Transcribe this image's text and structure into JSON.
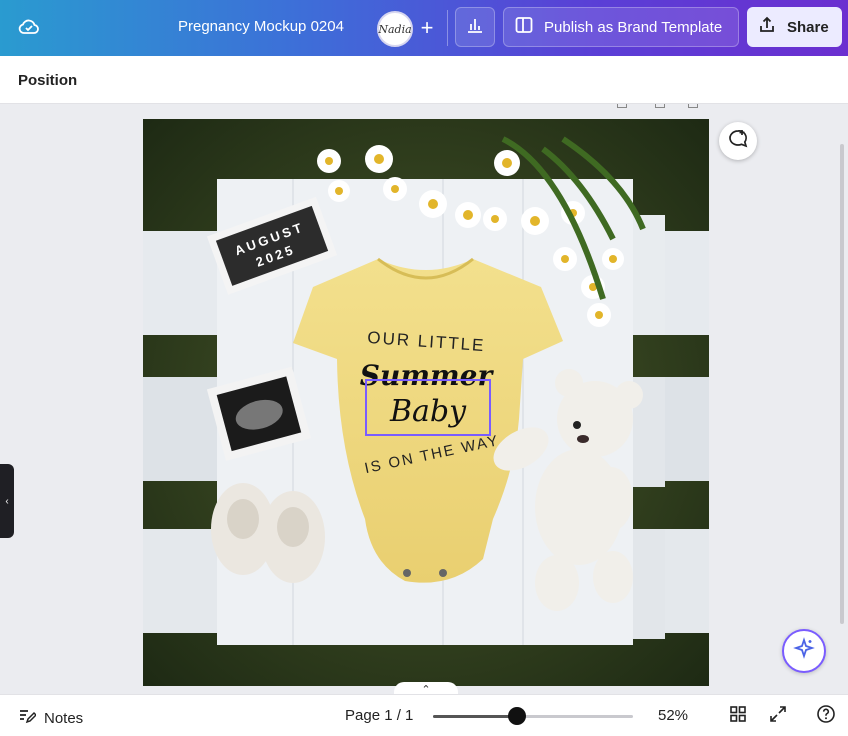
{
  "header": {
    "doc_title": "Pregnancy Mockup 0204",
    "avatar_text": "Nadia",
    "add_label": "+",
    "publish_label": "Publish as Brand Template",
    "share_label": "Share"
  },
  "toolbar": {
    "position_label": "Position"
  },
  "canvas": {
    "letterboard_line1": "AUGUST",
    "letterboard_line2": "2025",
    "onesie_line1": "OUR LITTLE",
    "onesie_line2": "Summer",
    "onesie_line3": "Baby",
    "onesie_line4": "IS ON THE WAY"
  },
  "footer": {
    "notes_label": "Notes",
    "page_indicator": "Page 1 / 1",
    "zoom_label": "52%",
    "zoom_fraction": 0.42
  },
  "colors": {
    "accent": "#7a5cff",
    "onesie": "#f2df8c",
    "wood": "#eef1f4"
  }
}
